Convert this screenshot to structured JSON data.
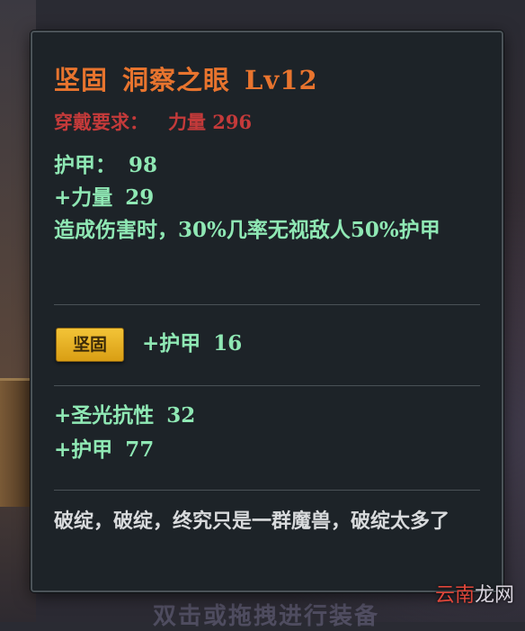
{
  "background": {
    "hint_text": "双击或拖拽进行装备"
  },
  "watermark": {
    "text_red": "云南",
    "text_rest": "龙网"
  },
  "item": {
    "quality": "坚固",
    "name": "洞察之眼",
    "level": "Lv12",
    "requirement": {
      "label": "穿戴要求：",
      "value": "力量  296"
    },
    "base_stats": [
      {
        "label": "护甲：",
        "value": "98"
      },
      {
        "label": "+力量",
        "value": "29"
      }
    ],
    "effect": "造成伤害时，30%几率无视敌人50%护甲",
    "affix": {
      "badge": "坚固",
      "label": "+护甲",
      "value": "16"
    },
    "bonus_stats": [
      {
        "label": "+圣光抗性",
        "value": "32"
      },
      {
        "label": "+护甲",
        "value": "77"
      }
    ],
    "flavor_text": "破绽，破绽，终究只是一群魔兽，破绽太多了"
  },
  "colors": {
    "title": "#e8742e",
    "requirement": "#c43a3a",
    "stat": "#8fe8b4",
    "badge": "#e8b62a",
    "flavor": "#d8dadc",
    "panel_bg": "#1d2328"
  }
}
